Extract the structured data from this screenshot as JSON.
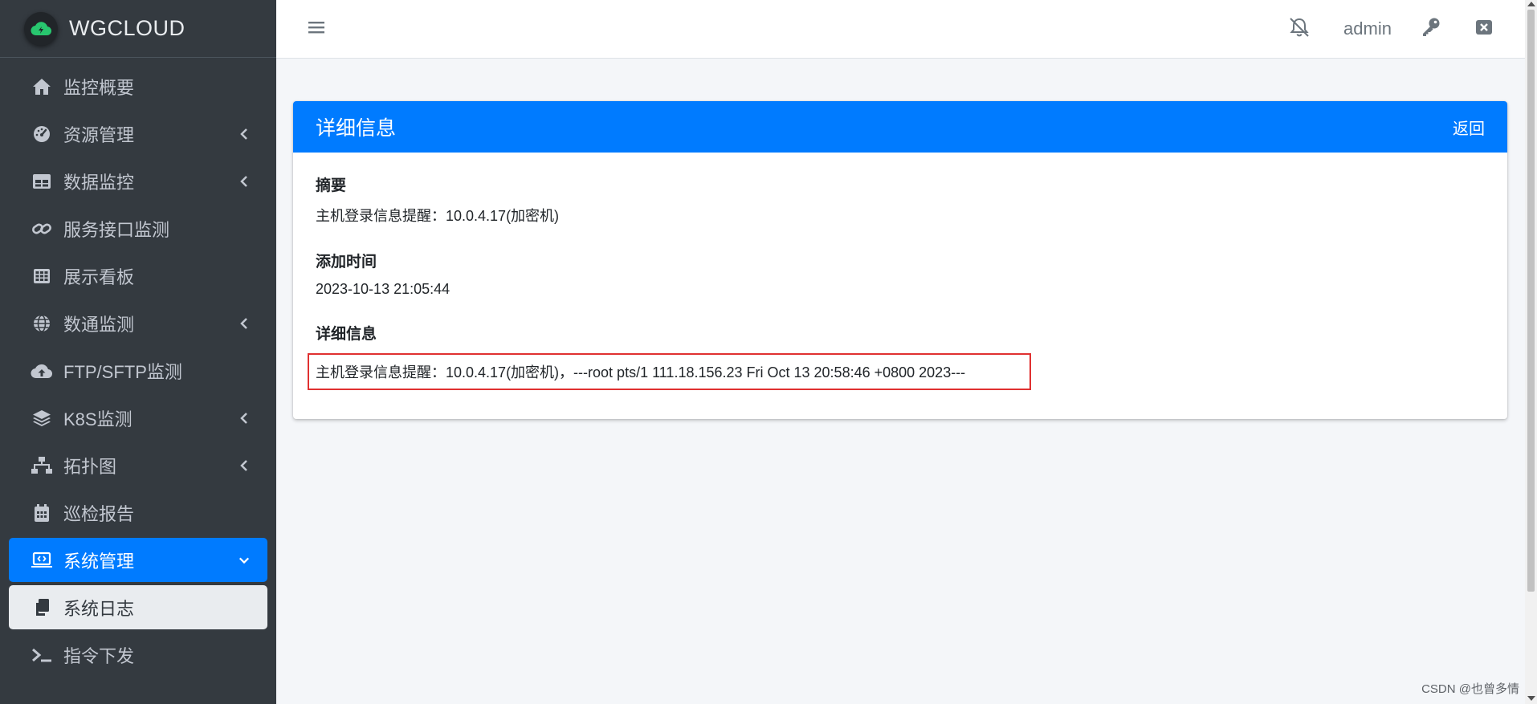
{
  "brand": {
    "name": "WGCLOUD"
  },
  "sidebar": {
    "items": [
      {
        "label": "监控概要",
        "icon": "home-icon",
        "has_submenu": false
      },
      {
        "label": "资源管理",
        "icon": "tachometer-icon",
        "has_submenu": true
      },
      {
        "label": "数据监控",
        "icon": "table-icon",
        "has_submenu": true
      },
      {
        "label": "服务接口监测",
        "icon": "link-icon",
        "has_submenu": false
      },
      {
        "label": "展示看板",
        "icon": "grid-icon",
        "has_submenu": false
      },
      {
        "label": "数通监测",
        "icon": "globe-icon",
        "has_submenu": true
      },
      {
        "label": "FTP/SFTP监测",
        "icon": "cloud-upload-icon",
        "has_submenu": false
      },
      {
        "label": "K8S监测",
        "icon": "layers-icon",
        "has_submenu": true
      },
      {
        "label": "拓扑图",
        "icon": "sitemap-icon",
        "has_submenu": true
      },
      {
        "label": "巡检报告",
        "icon": "calendar-icon",
        "has_submenu": false
      },
      {
        "label": "系统管理",
        "icon": "laptop-code-icon",
        "has_submenu": true,
        "state": "active"
      },
      {
        "label": "系统日志",
        "icon": "copy-icon",
        "has_submenu": false,
        "state": "current"
      },
      {
        "label": "指令下发",
        "icon": "terminal-icon",
        "has_submenu": false
      }
    ]
  },
  "topbar": {
    "menu_icon": "bars-icon",
    "notify_icon": "bell-slash-icon",
    "user": "admin",
    "key_icon": "key-icon",
    "close_icon": "window-close-icon"
  },
  "card": {
    "title": "详细信息",
    "back_label": "返回",
    "fields": {
      "summary_label": "摘要",
      "summary_value": "主机登录信息提醒：10.0.4.17(加密机)",
      "time_label": "添加时间",
      "time_value": "2023-10-13 21:05:44",
      "detail_label": "详细信息",
      "detail_value": "主机登录信息提醒：10.0.4.17(加密机)，---root pts/1 111.18.156.23 Fri Oct 13 20:58:46 +0800 2023---"
    }
  },
  "watermark": "CSDN @也曾多情",
  "colors": {
    "sidebar_bg": "#343a40",
    "accent": "#007bff",
    "highlight_border": "#e03131"
  }
}
